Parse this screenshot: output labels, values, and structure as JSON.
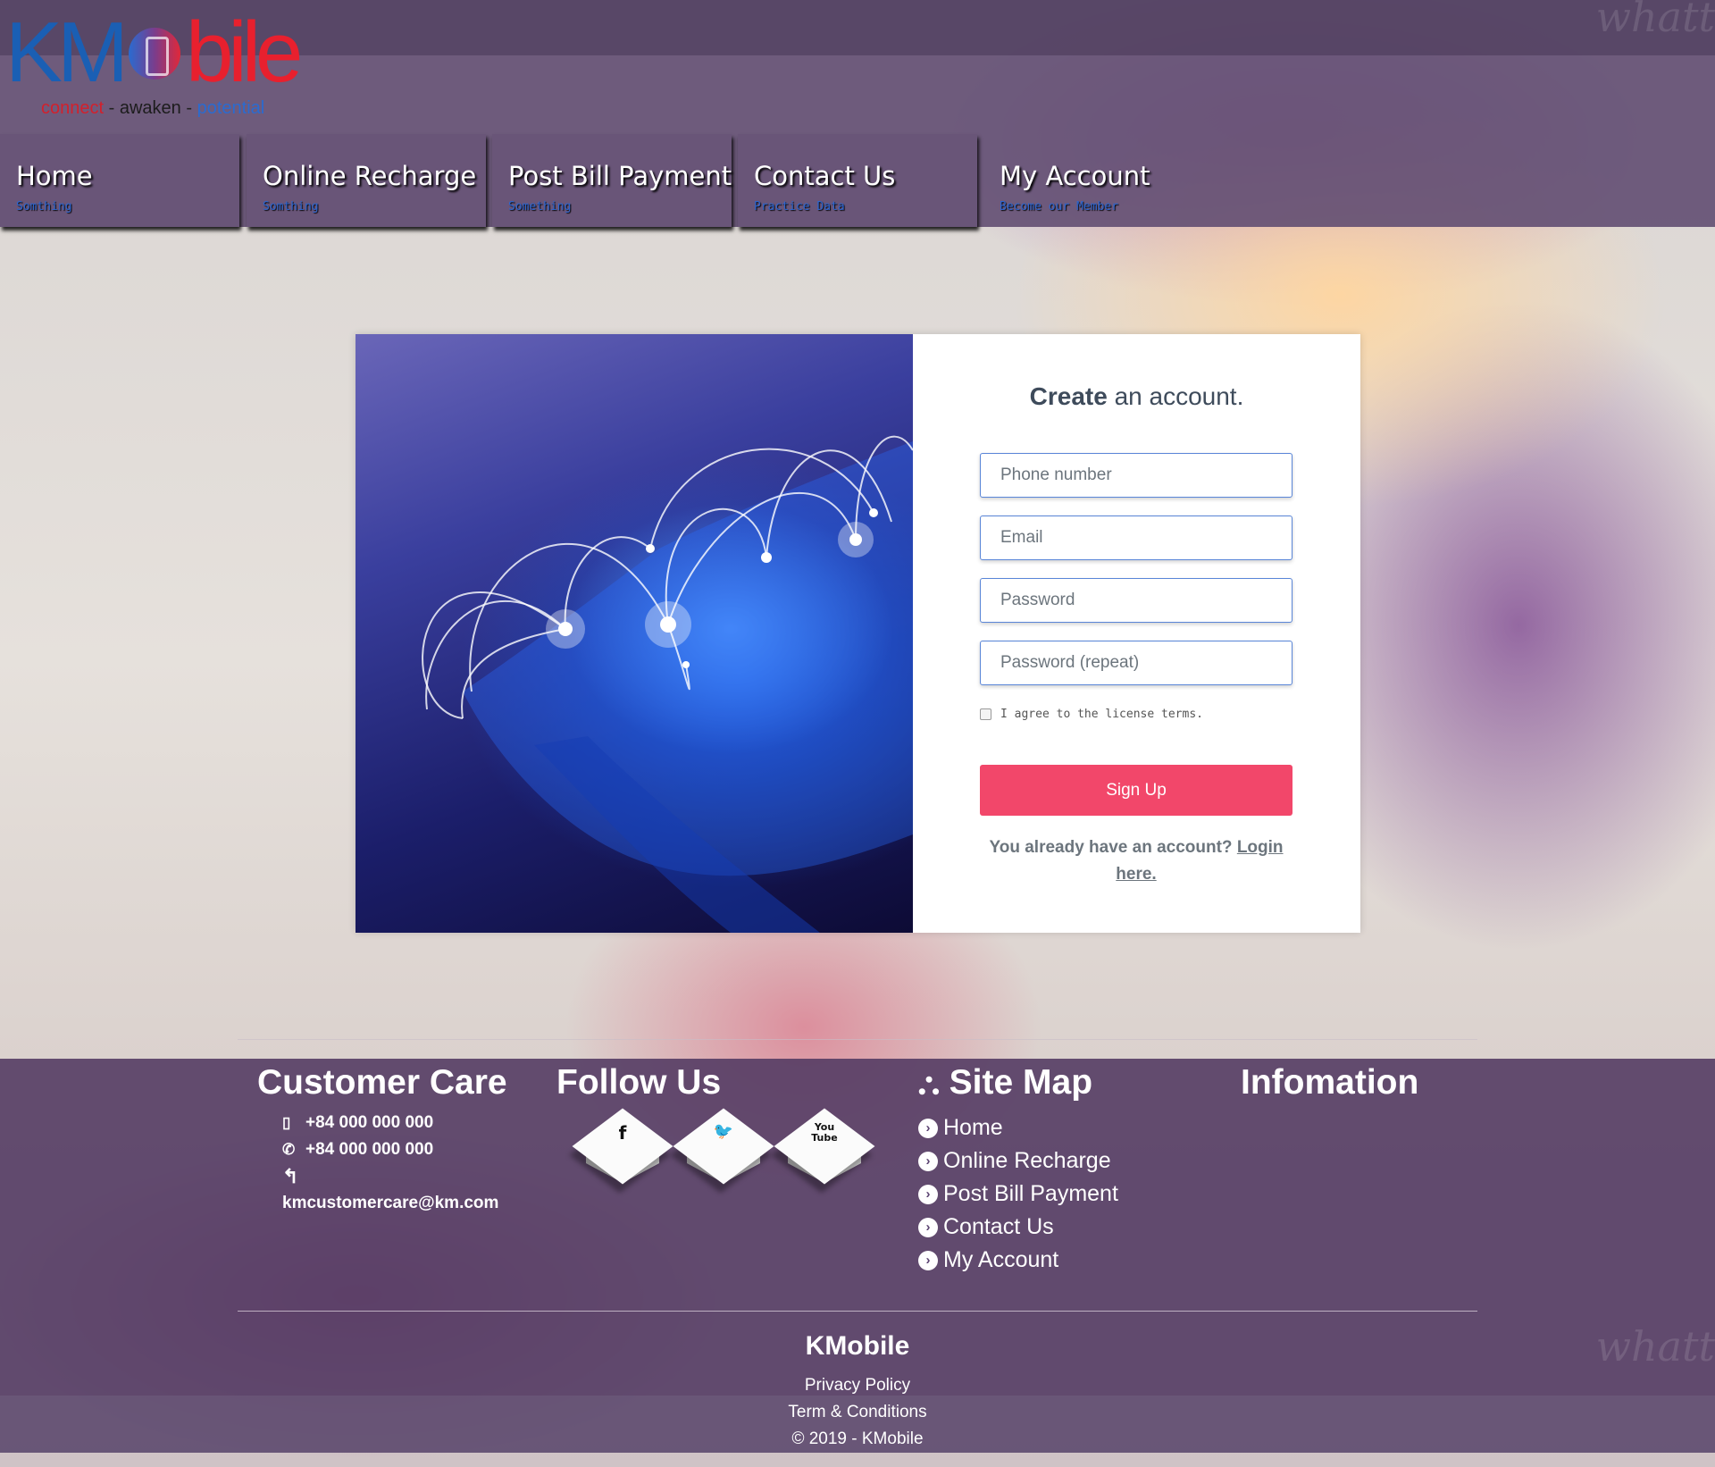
{
  "logo": {
    "word_left": "KM",
    "word_right": "bile",
    "tagline_1": "connect",
    "tagline_sep": "-",
    "tagline_2": "awaken",
    "tagline_3": "potential"
  },
  "nav": [
    {
      "label": "Home",
      "sub": "Somthing"
    },
    {
      "label": "Online Recharge",
      "sub": "Somthing"
    },
    {
      "label": "Post Bill Payment",
      "sub": "Something"
    },
    {
      "label": "Contact Us",
      "sub": "Practice Data"
    },
    {
      "label": "My Account",
      "sub": "Become our Member"
    }
  ],
  "signup": {
    "title_bold": "Create",
    "title_rest": "an account.",
    "phone_placeholder": "Phone number",
    "email_placeholder": "Email",
    "password_placeholder": "Password",
    "password_repeat_placeholder": "Password (repeat)",
    "agree_label": "I agree to the license terms.",
    "agree_checked": false,
    "button_label": "Sign Up",
    "already_text": "You already have an account?",
    "login_link": "Login here."
  },
  "footer": {
    "customer_care": {
      "heading": "Customer Care",
      "mobile": "+84 000 000 000",
      "phone": "+84 000 000 000",
      "email": "kmcustomercare@km.com"
    },
    "follow_us": {
      "heading": "Follow Us",
      "networks": [
        {
          "icon": "facebook-icon",
          "glyph": "f"
        },
        {
          "icon": "twitter-icon",
          "glyph": "🐦"
        },
        {
          "icon": "youtube-icon",
          "glyph": "You\nTube"
        }
      ]
    },
    "site_map": {
      "heading": "Site Map",
      "links": [
        "Home",
        "Online Recharge",
        "Post Bill Payment",
        "Contact Us",
        "My Account"
      ]
    },
    "information": {
      "heading": "Infomation"
    },
    "brand": "KMobile",
    "privacy": "Privacy Policy",
    "terms": "Term & Conditions",
    "copyright": "© 2019 - KMobile"
  },
  "colors": {
    "accent": "#f2476a",
    "nav_sub": "#2d66d0",
    "footer_bg": "#543c64",
    "logo_red": "#e8202e",
    "logo_blue": "#1a5fb4"
  }
}
